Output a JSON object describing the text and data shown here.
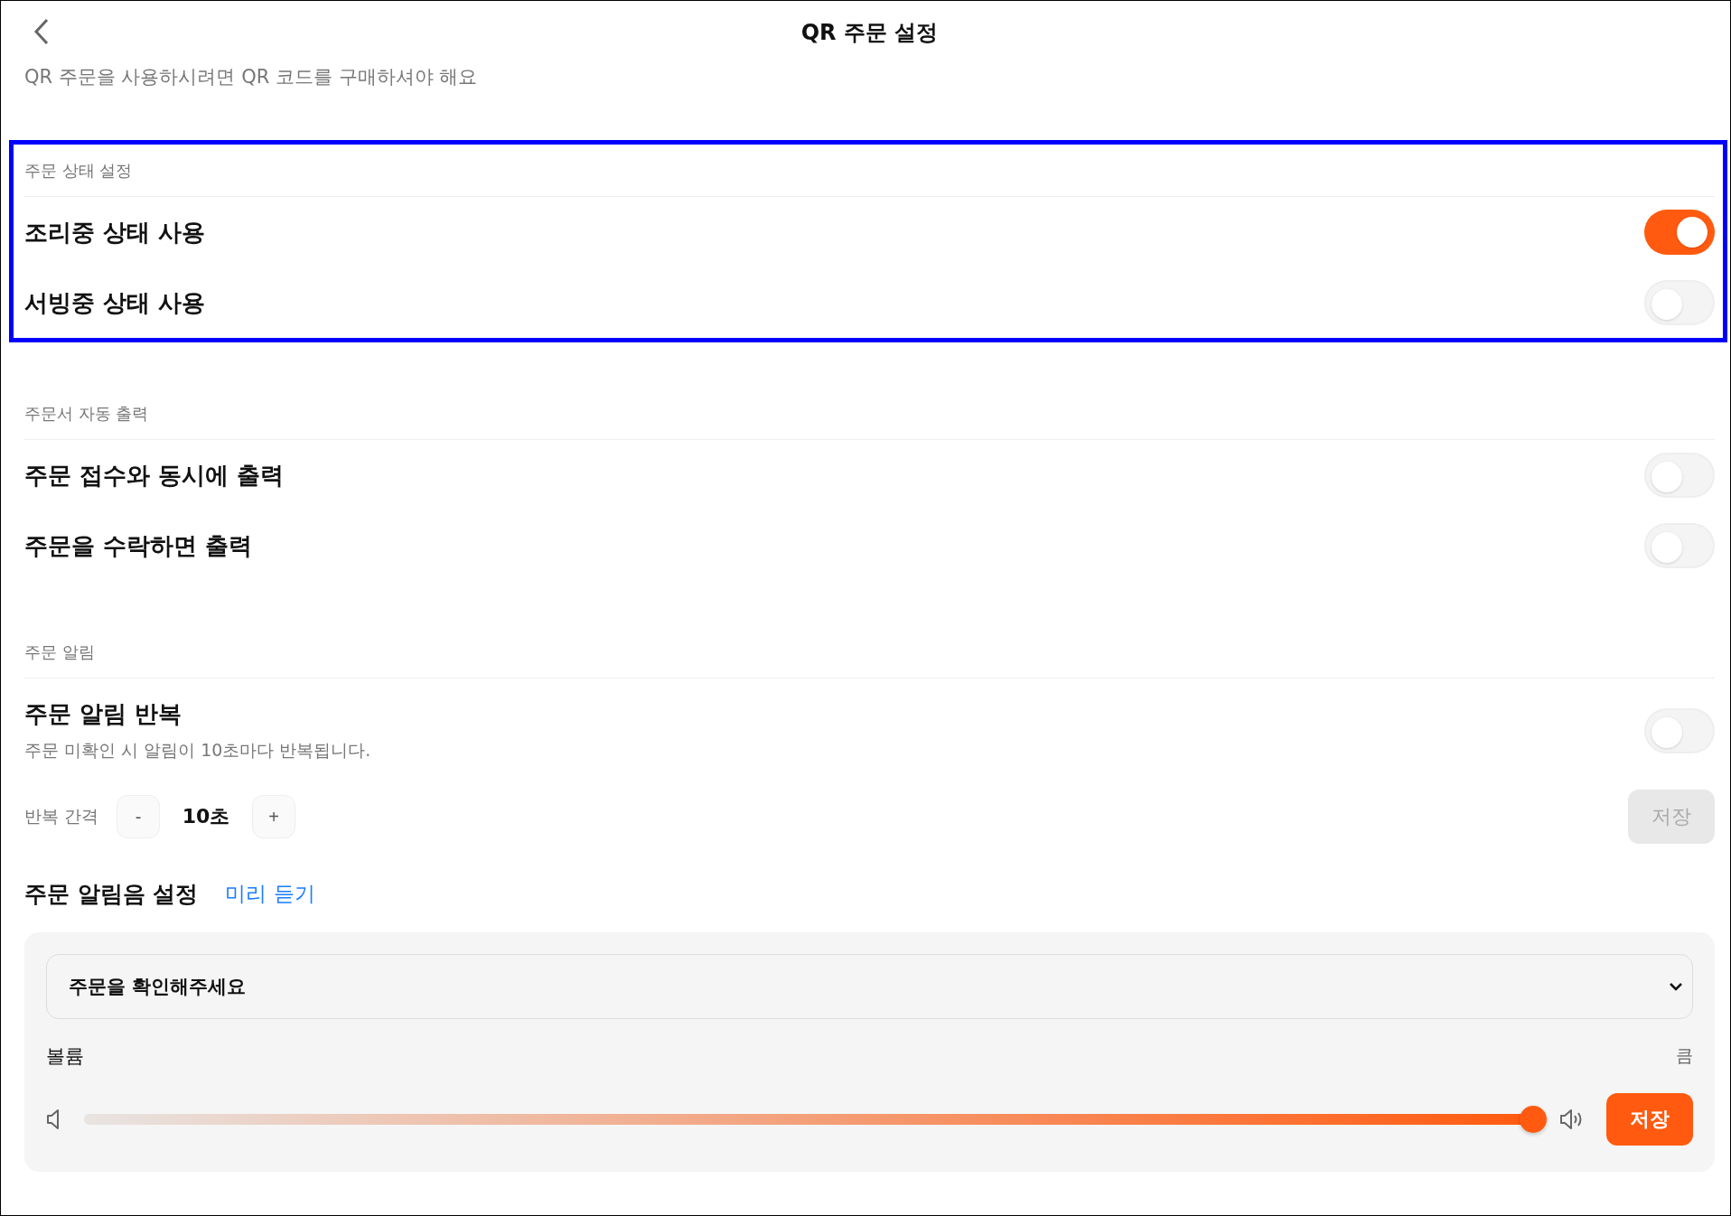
{
  "header": {
    "title": "QR 주문 설정",
    "subtitle": "QR 주문을 사용하시려면 QR 코드를 구매하셔야 해요"
  },
  "sections": [
    {
      "title": "주문 상태 설정",
      "highlighted": true,
      "rows": [
        {
          "label": "조리중 상태 사용",
          "on": true
        },
        {
          "label": "서빙중 상태 사용",
          "on": false
        }
      ]
    },
    {
      "title": "주문서 자동 출력",
      "rows": [
        {
          "label": "주문 접수와 동시에 출력",
          "on": false
        },
        {
          "label": "주문을 수락하면 출력",
          "on": false
        }
      ]
    },
    {
      "title": "주문 알림",
      "rows": [
        {
          "label": "주문 알림 반복",
          "description": "주문 미확인 시 알림이 10초마다 반복됩니다.",
          "on": false
        }
      ]
    }
  ],
  "interval": {
    "label": "반복 간격",
    "minus": "-",
    "value": "10초",
    "plus": "+",
    "save": "저장",
    "save_disabled": true
  },
  "sound": {
    "title": "주문 알림음 설정",
    "preview": "미리 듣기",
    "select_value": "주문을 확인해주세요",
    "volume_label": "볼륨",
    "volume_max": "큼",
    "level": 1.0,
    "save": "저장"
  }
}
